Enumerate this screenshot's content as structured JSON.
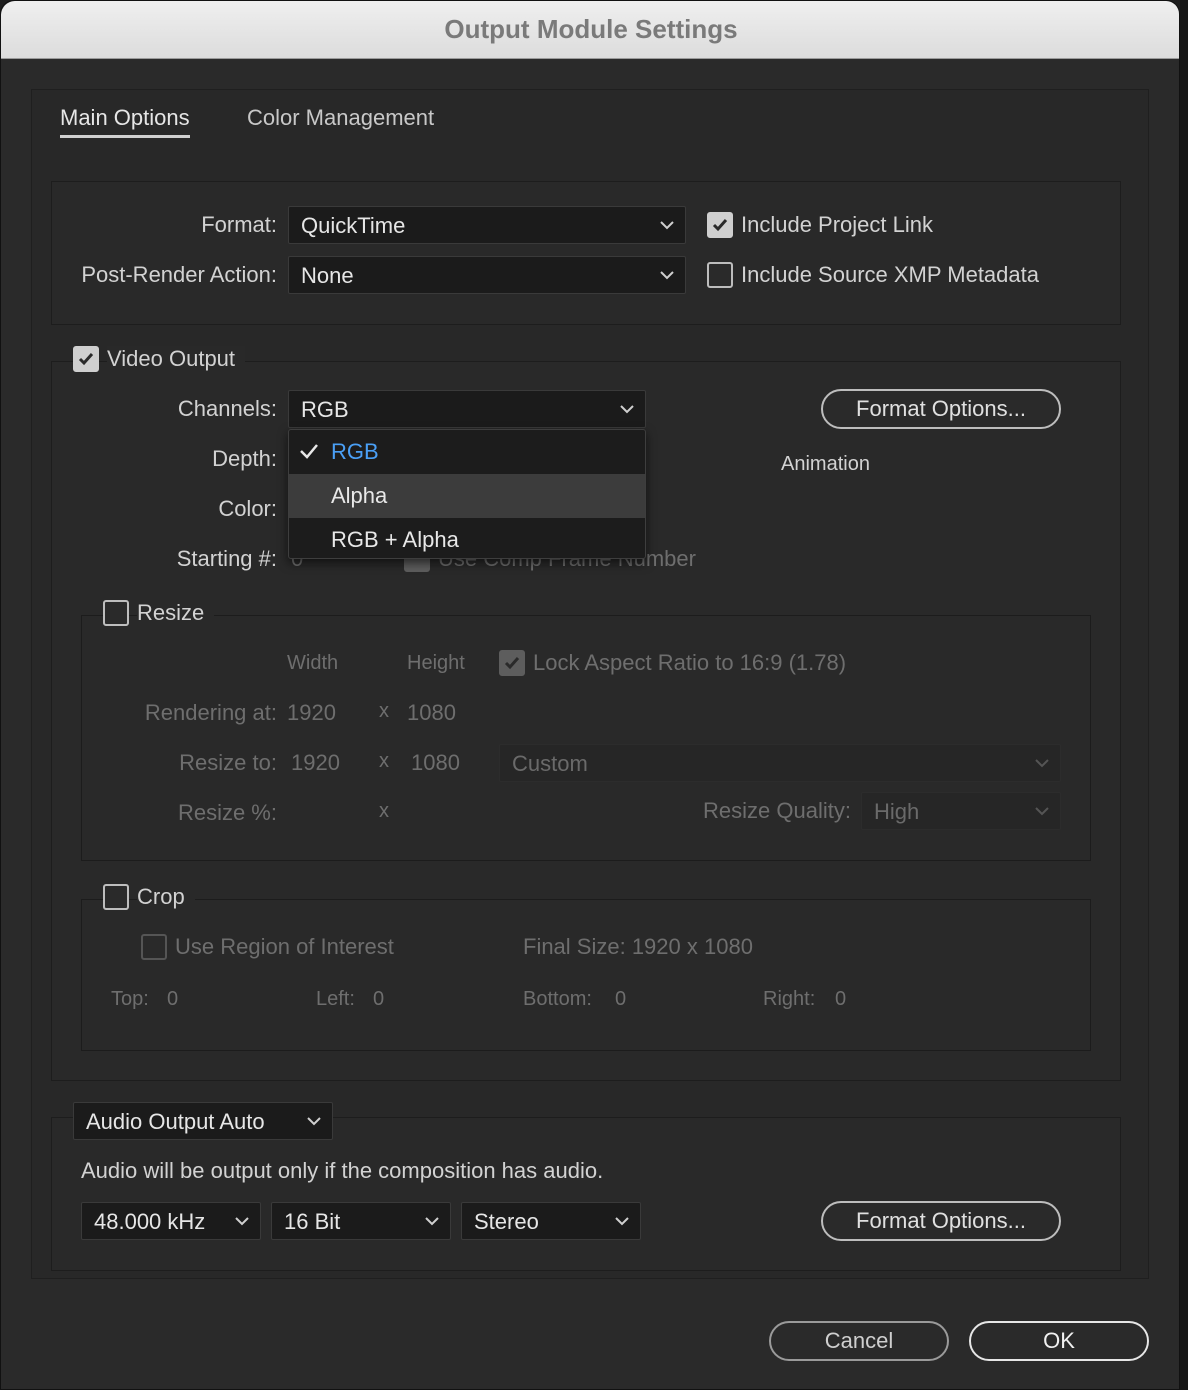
{
  "window": {
    "title": "Output Module Settings"
  },
  "tabs": [
    {
      "label": "Main Options",
      "active": true
    },
    {
      "label": "Color Management",
      "active": false
    }
  ],
  "main": {
    "format_label": "Format:",
    "format_value": "QuickTime",
    "post_render_label": "Post-Render Action:",
    "post_render_value": "None",
    "include_project_link": {
      "label": "Include Project Link",
      "checked": true
    },
    "include_xmp": {
      "label": "Include Source XMP Metadata",
      "checked": false
    }
  },
  "video": {
    "video_output": {
      "label": "Video Output",
      "checked": true
    },
    "channels_label": "Channels:",
    "channels_value": "RGB",
    "depth_label": "Depth:",
    "color_label": "Color:",
    "starting_label": "Starting #:",
    "starting_value": "0",
    "use_comp_frame": "Use Comp Frame Number",
    "format_options_label": "Format Options...",
    "codec_text": "Animation",
    "channels_menu": {
      "items": [
        {
          "label": "RGB",
          "selected": true
        },
        {
          "label": "Alpha",
          "selected": false,
          "hover": true
        },
        {
          "label": "RGB + Alpha",
          "selected": false
        }
      ]
    }
  },
  "resize": {
    "label": "Resize",
    "checked": false,
    "width_header": "Width",
    "height_header": "Height",
    "lock_aspect": {
      "label": "Lock Aspect Ratio to 16:9 (1.78)",
      "checked": true
    },
    "rendering_at_label": "Rendering at:",
    "rendering_w": "1920",
    "rendering_h": "1080",
    "resize_to_label": "Resize to:",
    "resize_to_w": "1920",
    "resize_to_h": "1080",
    "x_sep": "x",
    "preset_value": "Custom",
    "resize_pct_label": "Resize %:",
    "quality_label": "Resize Quality:",
    "quality_value": "High"
  },
  "crop": {
    "label": "Crop",
    "checked": false,
    "use_roi": {
      "label": "Use Region of Interest",
      "checked": false
    },
    "final_size": "Final Size: 1920 x 1080",
    "top_label": "Top:",
    "top_value": "0",
    "left_label": "Left:",
    "left_value": "0",
    "bottom_label": "Bottom:",
    "bottom_value": "0",
    "right_label": "Right:",
    "right_value": "0"
  },
  "audio": {
    "mode_value": "Audio Output Auto",
    "note": "Audio will be output only if the composition has audio.",
    "rate_value": "48.000 kHz",
    "bits_value": "16 Bit",
    "channels_value": "Stereo",
    "format_options_label": "Format Options..."
  },
  "footer": {
    "cancel_label": "Cancel",
    "ok_label": "OK"
  }
}
